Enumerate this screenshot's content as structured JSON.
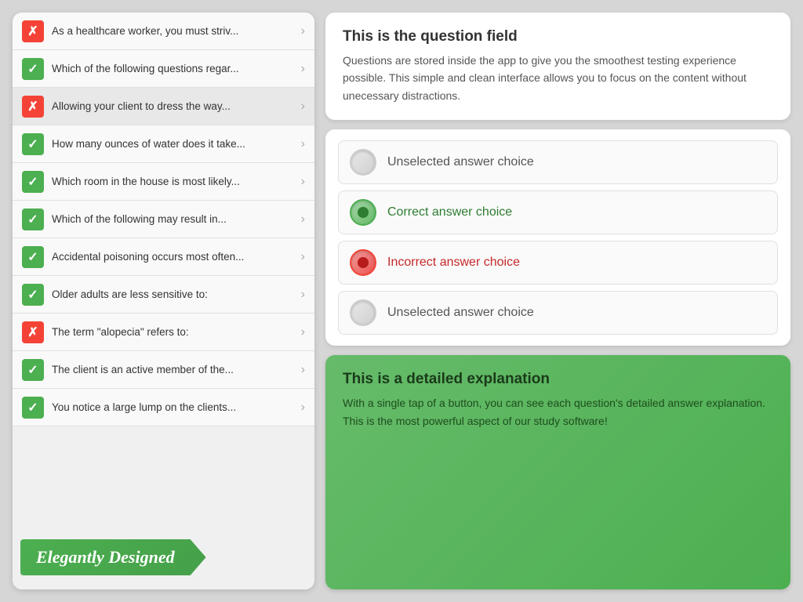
{
  "leftPanel": {
    "questions": [
      {
        "id": 1,
        "status": "wrong",
        "text": "As a healthcare worker, you must striv..."
      },
      {
        "id": 2,
        "status": "correct",
        "text": "Which of the following questions regar..."
      },
      {
        "id": 3,
        "status": "wrong",
        "text": "Allowing your client to dress the way...",
        "selected": true
      },
      {
        "id": 4,
        "status": "correct",
        "text": "How many ounces of water does it take..."
      },
      {
        "id": 5,
        "status": "correct",
        "text": "Which room in the house is most likely..."
      },
      {
        "id": 6,
        "status": "correct",
        "text": "Which of the following may result in..."
      },
      {
        "id": 7,
        "status": "correct",
        "text": "Accidental poisoning occurs most often..."
      },
      {
        "id": 8,
        "status": "correct",
        "text": "Older adults are less sensitive to:"
      },
      {
        "id": 9,
        "status": "wrong",
        "text": "The term \"alopecia\" refers to:"
      },
      {
        "id": 10,
        "status": "correct",
        "text": "The client is an active member of the..."
      },
      {
        "id": 11,
        "status": "correct",
        "text": "You notice a large lump on the clients..."
      }
    ],
    "banner": "Elegantly Designed"
  },
  "rightPanel": {
    "questionCard": {
      "title": "This is the question field",
      "body": "Questions are stored inside the app to give you the smoothest testing experience possible. This simple and clean interface allows you to focus on the content without unecessary distractions."
    },
    "answers": [
      {
        "id": 1,
        "state": "unselected",
        "label": "Unselected answer choice"
      },
      {
        "id": 2,
        "state": "correct",
        "label": "Correct answer choice"
      },
      {
        "id": 3,
        "state": "incorrect",
        "label": "Incorrect answer choice"
      },
      {
        "id": 4,
        "state": "unselected",
        "label": "Unselected answer choice"
      }
    ],
    "explanationCard": {
      "title": "This is a detailed explanation",
      "body": "With a single tap of a button, you can see each question's detailed answer explanation. This is the most powerful aspect of our study software!"
    }
  }
}
